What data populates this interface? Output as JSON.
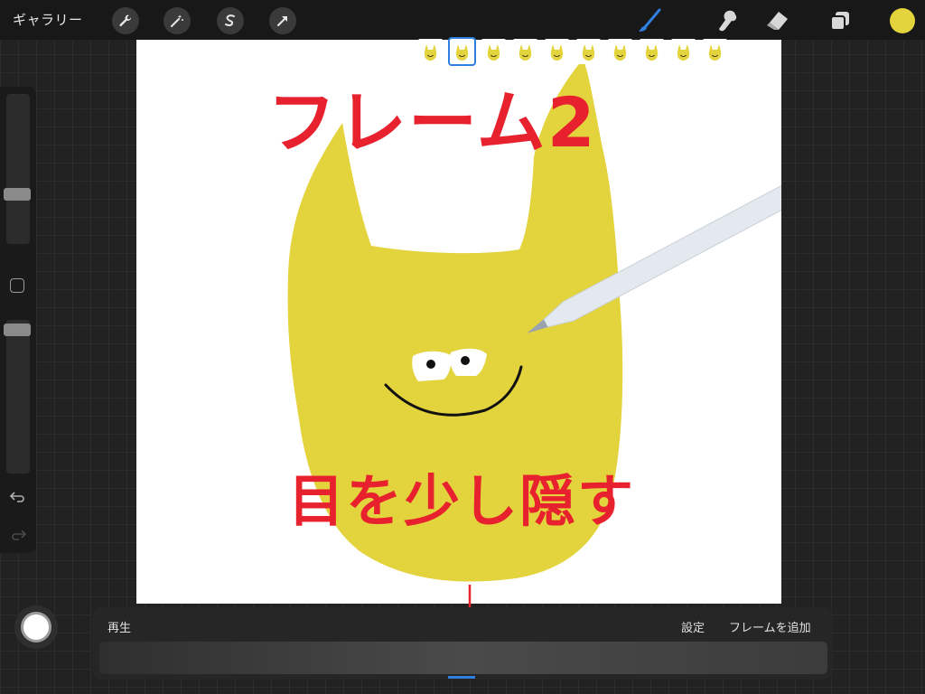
{
  "toolbar": {
    "gallery_label": "ギャラリー",
    "left_tools": [
      "wrench-icon",
      "magic-wand-icon",
      "selection-s-icon",
      "transform-arrow-icon"
    ],
    "right_tools": [
      "brush-icon",
      "smudge-icon",
      "eraser-icon",
      "layers-icon"
    ],
    "current_color": "#e3d33c"
  },
  "canvas": {
    "title_text": "フレーム2",
    "caption_text": "目を少し隠す",
    "annotation_color": "#e8212e",
    "character_color": "#e3d33c"
  },
  "animation": {
    "play_label": "再生",
    "settings_label": "設定",
    "add_frame_label": "フレームを追加",
    "frame_count": 10,
    "selected_frame": 2
  },
  "colors": {
    "accent_blue": "#2f7fe0",
    "toolbar_bg": "#181818"
  }
}
